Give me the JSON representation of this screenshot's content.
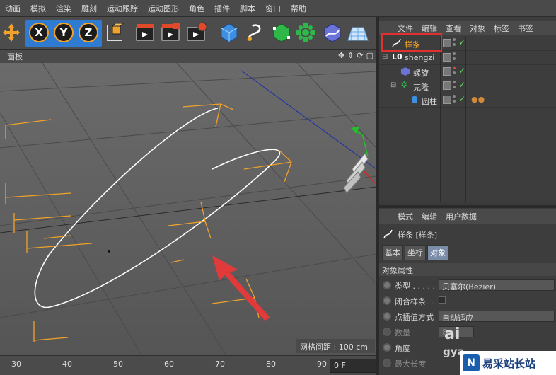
{
  "menu": [
    "动画",
    "模拟",
    "渲染",
    "雕刻",
    "运动跟踪",
    "运动图形",
    "角色",
    "插件",
    "脚本",
    "窗口",
    "帮助"
  ],
  "toolbar": {
    "axes": [
      "X",
      "Y",
      "Z"
    ]
  },
  "viewport": {
    "title": "面板",
    "grid_spacing": "网格间距 : 100 cm",
    "icons": [
      "move-icon",
      "zoom-icon",
      "rotate-icon",
      "maximize-icon"
    ]
  },
  "timeline": {
    "ticks": [
      "30",
      "40",
      "50",
      "60",
      "70",
      "80",
      "90"
    ],
    "frame": "0 F"
  },
  "objects_panel": {
    "menu": [
      "文件",
      "编辑",
      "查看",
      "对象",
      "标签",
      "书签"
    ],
    "items": [
      {
        "name": "样条"
      },
      {
        "name": "shengzi"
      },
      {
        "name": "螺旋"
      },
      {
        "name": "克隆"
      },
      {
        "name": "圆柱"
      }
    ]
  },
  "attributes_panel": {
    "menu": [
      "模式",
      "编辑",
      "用户数据"
    ],
    "object_label": "样条 [样条]",
    "tabs": [
      "基本",
      "坐标",
      "对象"
    ],
    "section": "对象属性",
    "props": [
      {
        "label": "类型 . . . . .",
        "value": "贝塞尔(Bezier)"
      },
      {
        "label": "闭合样条. .",
        "value": ""
      },
      {
        "label": "点插值方式",
        "value": "自动适应"
      },
      {
        "label": "数量",
        "value": "8"
      },
      {
        "label": "角度",
        "value": ""
      },
      {
        "label": "最大长度",
        "value": ""
      }
    ]
  },
  "watermark": {
    "text": "易采站长站",
    "ghost": "ai",
    "ghost2": "gya"
  },
  "colors": {
    "accent_orange": "#f0a22a",
    "axis_blue": "#2e7bd1",
    "highlight_red": "#e03030",
    "check_green": "#5fdc5f"
  }
}
